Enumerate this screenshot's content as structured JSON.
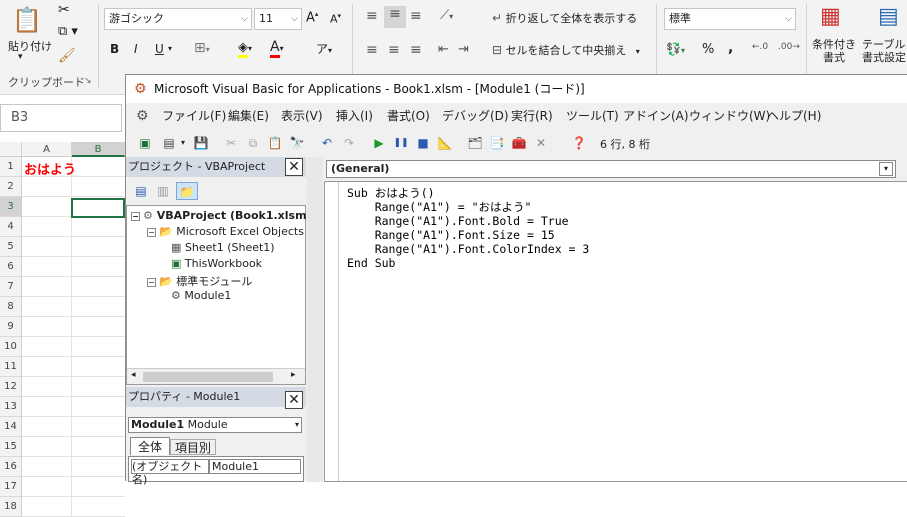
{
  "ribbon": {
    "paste_label": "貼り付け",
    "clipboard_label": "クリップボード",
    "font_name": "游ゴシック",
    "font_size": "11",
    "bold": "B",
    "italic": "I",
    "underline": "U",
    "wrap_text_label": "折り返して全体を表示する",
    "merge_label": "セルを結合して中央揃え",
    "number_format": "標準",
    "percent": "%",
    "comma": ",",
    "conditional_label_1": "条件付き",
    "conditional_label_2": "書式",
    "table_label_1": "テーブルと",
    "table_label_2": "書式設定"
  },
  "sheet": {
    "name_box": "B3",
    "columns": [
      "A",
      "B"
    ],
    "rows": [
      "1",
      "2",
      "3",
      "4",
      "5",
      "6",
      "7",
      "8",
      "9",
      "10",
      "11",
      "12",
      "13",
      "14",
      "15",
      "16",
      "17",
      "18"
    ],
    "a1_value": "おはよう",
    "a1_color": "#ff0000",
    "selection_color": "#217346"
  },
  "vbe": {
    "title": "Microsoft Visual Basic for Applications - Book1.xlsm - [Module1 (コード)]",
    "menu": [
      "ファイル(F)",
      "編集(E)",
      "表示(V)",
      "挿入(I)",
      "書式(O)",
      "デバッグ(D)",
      "実行(R)",
      "ツール(T)",
      "アドイン(A)",
      "ウィンドウ(W)",
      "ヘルプ(H)"
    ],
    "position": "6 行, 8 桁",
    "project_title": "プロジェクト - VBAProject",
    "tree": {
      "root": "VBAProject (Book1.xlsm)",
      "folder1": "Microsoft Excel Objects",
      "sheet1": "Sheet1 (Sheet1)",
      "workbook": "ThisWorkbook",
      "folder2": "標準モジュール",
      "module": "Module1"
    },
    "properties_title": "プロパティ - Module1",
    "properties_object": "Module1",
    "properties_type": "Module",
    "tab_all": "全体",
    "tab_category": "項目別",
    "prop_name_label": "(オブジェクト名)",
    "prop_name_value": "Module1",
    "code_object": "(General)",
    "code": [
      "Sub おはよう()",
      "    Range(\"A1\") = \"おはよう\"",
      "    Range(\"A1\").Font.Bold = True",
      "    Range(\"A1\").Font.Size = 15",
      "    Range(\"A1\").Font.ColorIndex = 3",
      "End Sub"
    ]
  }
}
